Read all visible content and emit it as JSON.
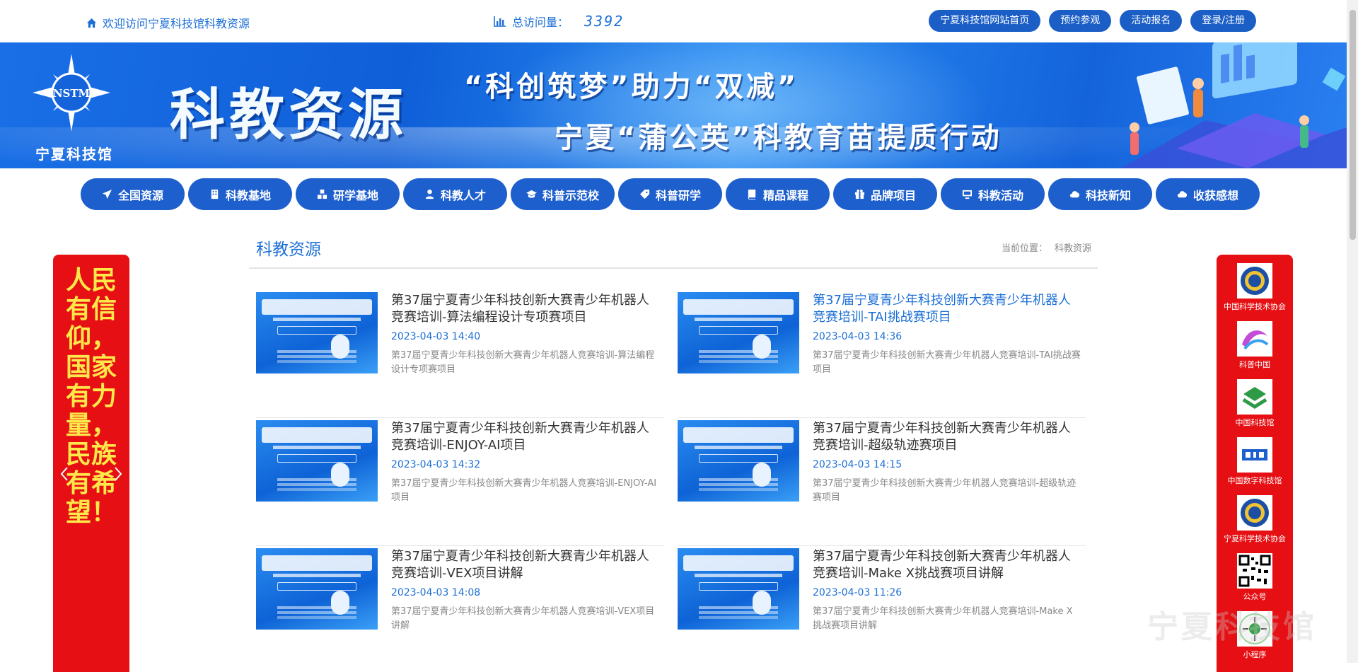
{
  "topbar": {
    "welcome": "欢迎访问宁夏科技馆科教资源",
    "visits_label": "总访问量：",
    "visits_count": "3392",
    "links": [
      "宁夏科技馆网站首页",
      "预约参观",
      "活动报名",
      "登录/注册"
    ]
  },
  "banner": {
    "logo_text": "宁夏科技馆",
    "logo_mark": "NSTM",
    "title": "科教资源",
    "slogan_line1": "“科创筑梦”助力“双减”",
    "slogan_line2": "宁夏“蒲公英”科教育苗提质行动"
  },
  "nav": [
    {
      "label": "全国资源",
      "icon": "paper-plane-icon"
    },
    {
      "label": "科教基地",
      "icon": "building-icon"
    },
    {
      "label": "研学基地",
      "icon": "cubes-icon"
    },
    {
      "label": "科教人才",
      "icon": "user-icon"
    },
    {
      "label": "科普示范校",
      "icon": "graduation-cap-icon"
    },
    {
      "label": "科普研学",
      "icon": "tag-icon"
    },
    {
      "label": "精品课程",
      "icon": "book-icon"
    },
    {
      "label": "品牌项目",
      "icon": "gift-icon"
    },
    {
      "label": "科教活动",
      "icon": "monitor-icon"
    },
    {
      "label": "科技新知",
      "icon": "cloud-icon"
    },
    {
      "label": "收获感想",
      "icon": "cloud-icon"
    }
  ],
  "left_banner": {
    "text": "人民有信仰，国家有力量，民族有希望！"
  },
  "main": {
    "section_title": "科教资源",
    "breadcrumb_label": "当前位置：",
    "breadcrumb_current": "科教资源",
    "articles": [
      {
        "title": "第37届宁夏青少年科技创新大赛青少年机器人竞赛培训-算法编程设计专项赛项目",
        "date": "2023-04-03 14:40",
        "desc": "第37届宁夏青少年科技创新大赛青少年机器人竞赛培训-算法编程设计专项赛项目"
      },
      {
        "title": "第37届宁夏青少年科技创新大赛青少年机器人竞赛培训-TAI挑战赛项目",
        "date": "2023-04-03 14:36",
        "desc": "第37届宁夏青少年科技创新大赛青少年机器人竞赛培训-TAI挑战赛项目"
      },
      {
        "title": "第37届宁夏青少年科技创新大赛青少年机器人竞赛培训-ENJOY-AI项目",
        "date": "2023-04-03 14:32",
        "desc": "第37届宁夏青少年科技创新大赛青少年机器人竞赛培训-ENJOY-AI项目"
      },
      {
        "title": "第37届宁夏青少年科技创新大赛青少年机器人竞赛培训-超级轨迹赛项目",
        "date": "2023-04-03 14:15",
        "desc": "第37届宁夏青少年科技创新大赛青少年机器人竞赛培训-超级轨迹赛项目"
      },
      {
        "title": "第37届宁夏青少年科技创新大赛青少年机器人竞赛培训-VEX项目讲解",
        "date": "2023-04-03 14:08",
        "desc": "第37届宁夏青少年科技创新大赛青少年机器人竞赛培训-VEX项目讲解"
      },
      {
        "title": "第37届宁夏青少年科技创新大赛青少年机器人竞赛培训-Make X挑战赛项目讲解",
        "date": "2023-04-03 11:26",
        "desc": "第37届宁夏青少年科技创新大赛青少年机器人竞赛培训-Make X挑战赛项目讲解"
      }
    ]
  },
  "sidebar": {
    "partners": [
      "中国科学技术协会",
      "科普中国",
      "中国科技馆",
      "中国数字科技馆",
      "宁夏科学技术协会",
      "公众号",
      "小程序"
    ]
  },
  "watermark": "宁夏科技馆",
  "colors": {
    "primary": "#1c5fcd",
    "link": "#1c6fd6",
    "red": "#e60f13",
    "gold": "#ffe94a"
  }
}
